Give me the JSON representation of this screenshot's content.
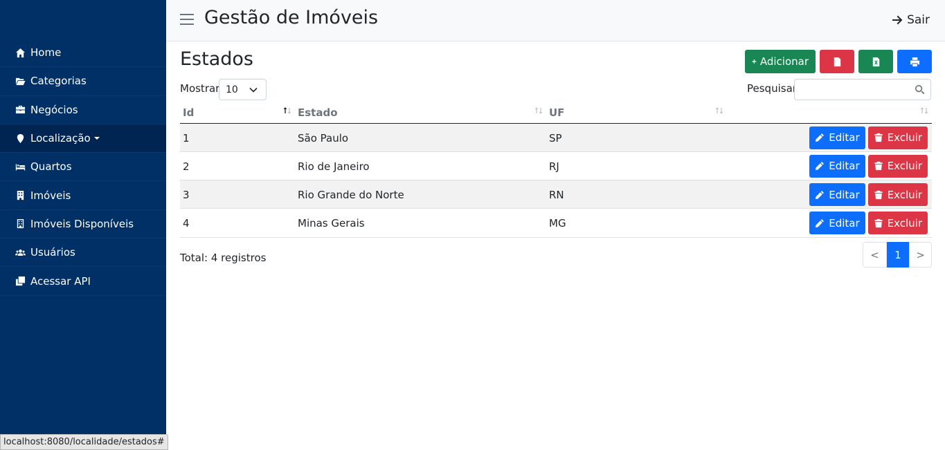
{
  "app": {
    "title": "Gestão de Imóveis",
    "logout_label": "Sair"
  },
  "sidebar": {
    "items": [
      {
        "label": "Home",
        "icon": "home-icon"
      },
      {
        "label": "Categorias",
        "icon": "folder-open-icon"
      },
      {
        "label": "Negócios",
        "icon": "briefcase-icon"
      },
      {
        "label": "Localização",
        "icon": "map-marker-icon",
        "dropdown": true
      },
      {
        "label": "Quartos",
        "icon": "bed-icon"
      },
      {
        "label": "Imóveis",
        "icon": "building-icon"
      },
      {
        "label": "Imóveis Disponíveis",
        "icon": "building-outline-icon"
      },
      {
        "label": "Usuários",
        "icon": "users-icon"
      },
      {
        "label": "Acessar API",
        "icon": "clone-icon"
      }
    ]
  },
  "page": {
    "title": "Estados",
    "add_label": "Adicionar",
    "show_label": "Mostrar",
    "page_size": "10",
    "search_label": "Pesquisar",
    "search_value": ""
  },
  "table": {
    "columns": [
      "Id",
      "Estado",
      "UF",
      ""
    ],
    "rows": [
      {
        "id": "1",
        "estado": "São Paulo",
        "uf": "SP"
      },
      {
        "id": "2",
        "estado": "Rio de Janeiro",
        "uf": "RJ"
      },
      {
        "id": "3",
        "estado": "Rio Grande do Norte",
        "uf": "RN"
      },
      {
        "id": "4",
        "estado": "Minas Gerais",
        "uf": "MG"
      }
    ],
    "edit_label": "Editar",
    "delete_label": "Excluir"
  },
  "footer": {
    "total": "Total: 4 registros",
    "pagination": {
      "prev": "<",
      "current": "1",
      "next": ">"
    }
  },
  "status_url": "localhost:8080/localidade/estados#",
  "colors": {
    "sidebar": "#013066",
    "primary": "#0d6efd",
    "success": "#198754",
    "danger": "#dc3545"
  }
}
